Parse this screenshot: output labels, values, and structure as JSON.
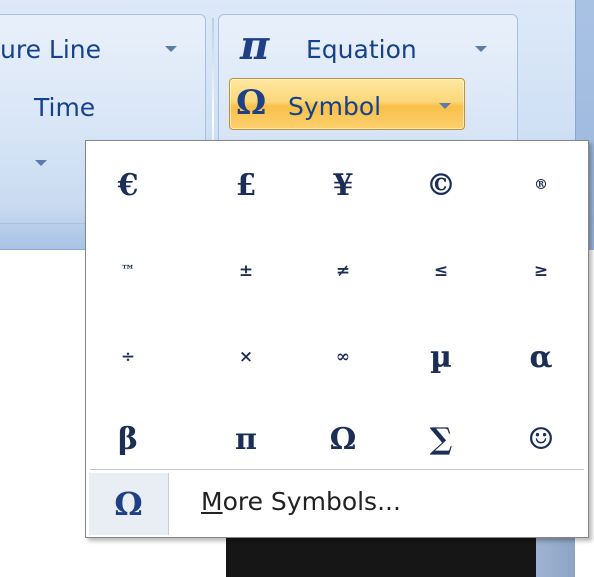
{
  "ribbon": {
    "insert_line_label": "ure Line",
    "date_time_label": "Time",
    "equation_label": "Equation",
    "equation_icon": "π",
    "symbol_label": "Symbol",
    "symbol_icon": "Ω"
  },
  "symbol_gallery": {
    "symbols": [
      {
        "char": "€",
        "name": "euro-symbol"
      },
      {
        "char": "£",
        "name": "pound-symbol"
      },
      {
        "char": "¥",
        "name": "yen-symbol"
      },
      {
        "char": "©",
        "name": "copyright-symbol"
      },
      {
        "char": "®",
        "name": "registered-symbol"
      },
      {
        "char": "™",
        "name": "trademark-symbol"
      },
      {
        "char": "±",
        "name": "plus-minus-symbol"
      },
      {
        "char": "≠",
        "name": "not-equal-symbol"
      },
      {
        "char": "≤",
        "name": "less-equal-symbol"
      },
      {
        "char": "≥",
        "name": "greater-equal-symbol"
      },
      {
        "char": "÷",
        "name": "division-symbol"
      },
      {
        "char": "×",
        "name": "multiplication-symbol"
      },
      {
        "char": "∞",
        "name": "infinity-symbol"
      },
      {
        "char": "µ",
        "name": "micro-symbol"
      },
      {
        "char": "α",
        "name": "alpha-symbol"
      },
      {
        "char": "β",
        "name": "beta-symbol"
      },
      {
        "char": "π",
        "name": "pi-symbol"
      },
      {
        "char": "Ω",
        "name": "omega-symbol"
      },
      {
        "char": "∑",
        "name": "sigma-symbol"
      },
      {
        "char": "☺",
        "name": "smiley-symbol"
      }
    ],
    "more_label_access": "M",
    "more_label_rest": "ore Symbols...",
    "more_icon": "Ω"
  }
}
